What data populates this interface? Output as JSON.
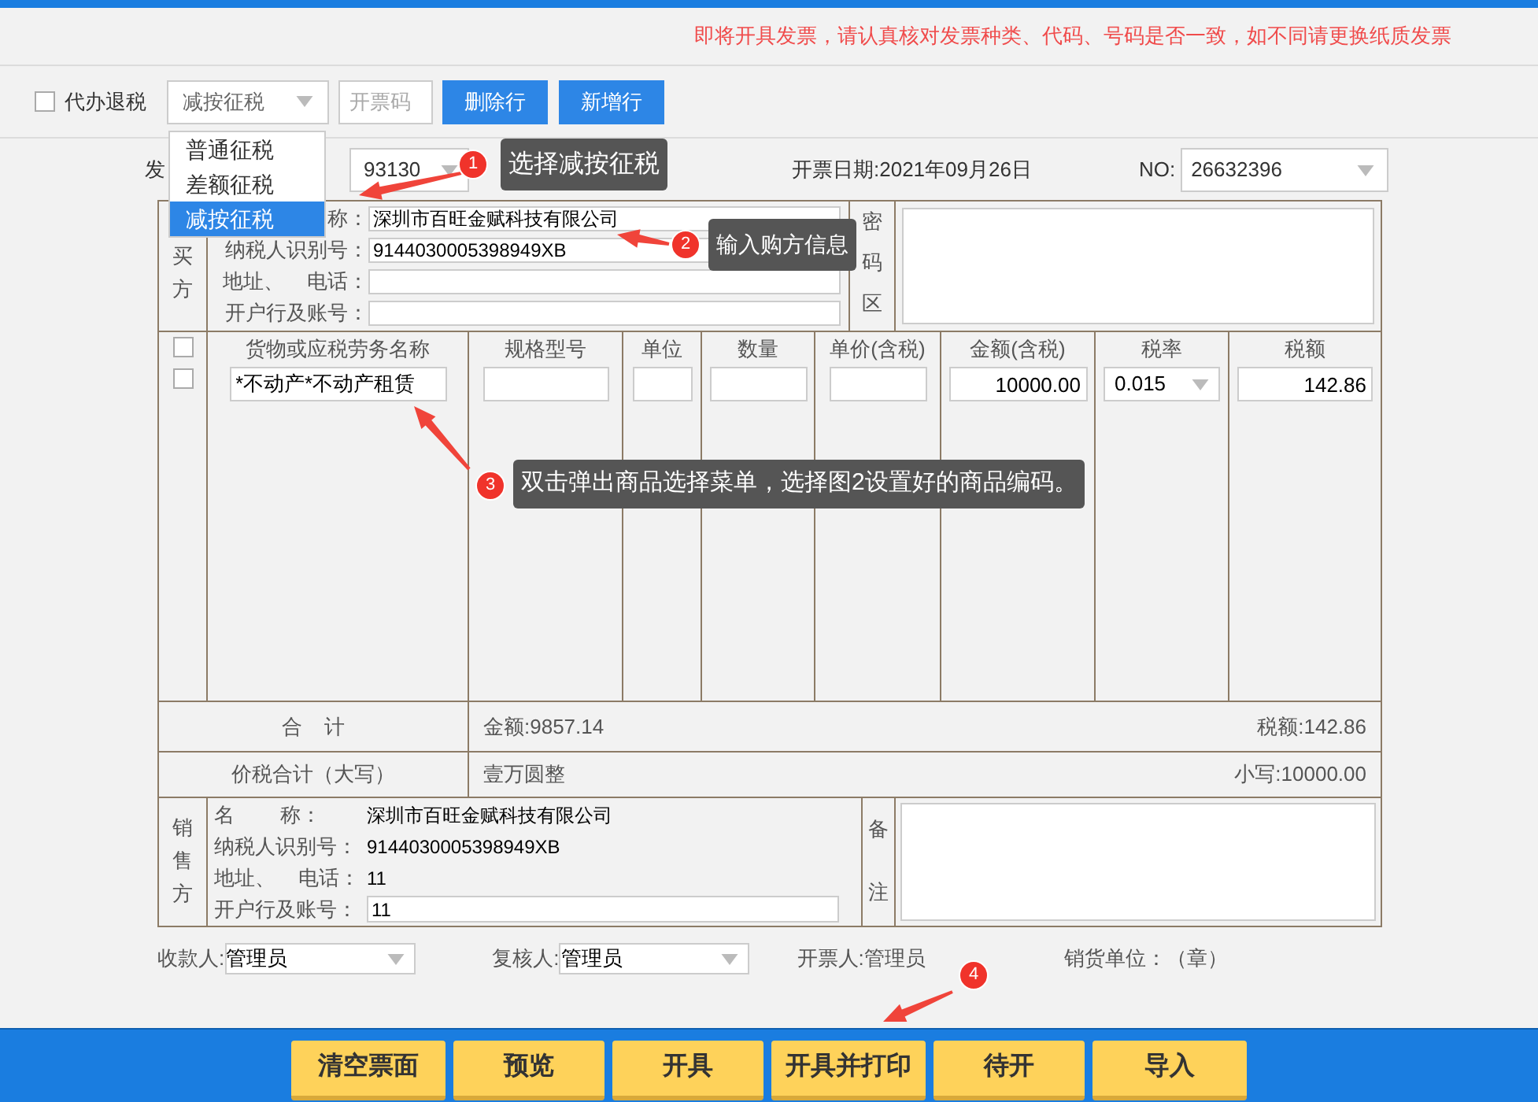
{
  "notice": "即将开具发票，请认真核对发票种类、代码、号码是否一致，如不同请更换纸质发票",
  "toolbar": {
    "agent_refund": {
      "label": "代办退税",
      "checked": false
    },
    "tax_method": {
      "value": "减按征税",
      "menu": [
        {
          "label": "普通征税",
          "selected": false
        },
        {
          "label": "差额征税",
          "selected": false
        },
        {
          "label": "减按征税",
          "selected": true
        }
      ]
    },
    "code_field": {
      "placeholder": "开票码"
    },
    "buttons": [
      "删除行",
      "新增行"
    ]
  },
  "header": {
    "code_label": "发",
    "code_value": "93130",
    "date": "开票日期:2021年09月26日",
    "no_label": "NO:",
    "no_value": "26632396"
  },
  "buyer": {
    "side_label": "买方",
    "fields": [
      {
        "label": "称：",
        "value": "深圳市百旺金赋科技有限公司"
      },
      {
        "label": "纳税人识别号：",
        "value": "9144030005398949XB"
      },
      {
        "label": "地址、    电话："
      },
      {
        "label": "开户行及账号："
      }
    ],
    "cipher_label": "密码区"
  },
  "goods": {
    "header_checked": false,
    "columns": [
      "货物或应税劳务名称",
      "规格型号",
      "单位",
      "数量",
      "单价(含税)",
      "金额(含税)",
      "税率",
      "税额"
    ],
    "rows": [
      {
        "checked": false,
        "name": "*不动产*不动产租赁",
        "amount": "10000.00",
        "rate": "0.015",
        "tax": "142.86"
      }
    ]
  },
  "totals": {
    "label": "合    计",
    "amount": "金额:9857.14",
    "tax": "税额:142.86"
  },
  "grand_total": {
    "label": "价税合计（大写）",
    "words": "壹万圆整",
    "figure": "小写:10000.00"
  },
  "seller": {
    "side_label": "销售方",
    "fields": [
      {
        "kind": "text",
        "label": "名        称：",
        "value": "深圳市百旺金赋科技有限公司"
      },
      {
        "kind": "text",
        "label": "纳税人识别号：",
        "value": "9144030005398949XB"
      },
      {
        "kind": "text",
        "label": "地址、    电话：",
        "value": "11"
      },
      {
        "kind": "input",
        "label": "开户行及账号：",
        "value": "11"
      }
    ],
    "remarks_label": "备注"
  },
  "signers": {
    "payee_label": "收款人:",
    "payee": "管理员",
    "reviewer_label": "复核人:",
    "reviewer": "管理员",
    "issuer": "开票人:管理员",
    "seller_unit": "销货单位：（章）"
  },
  "actions": [
    "清空票面",
    "预览",
    "开具",
    "开具并打印",
    "待开",
    "导入"
  ],
  "annotations": [
    {
      "number": "1",
      "text": "选择减按征税"
    },
    {
      "number": "2",
      "text": "输入购方信息"
    },
    {
      "number": "3",
      "text": "双击弹出商品选择菜单，选择图2设置好的商品编码。"
    },
    {
      "number": "4"
    }
  ]
}
